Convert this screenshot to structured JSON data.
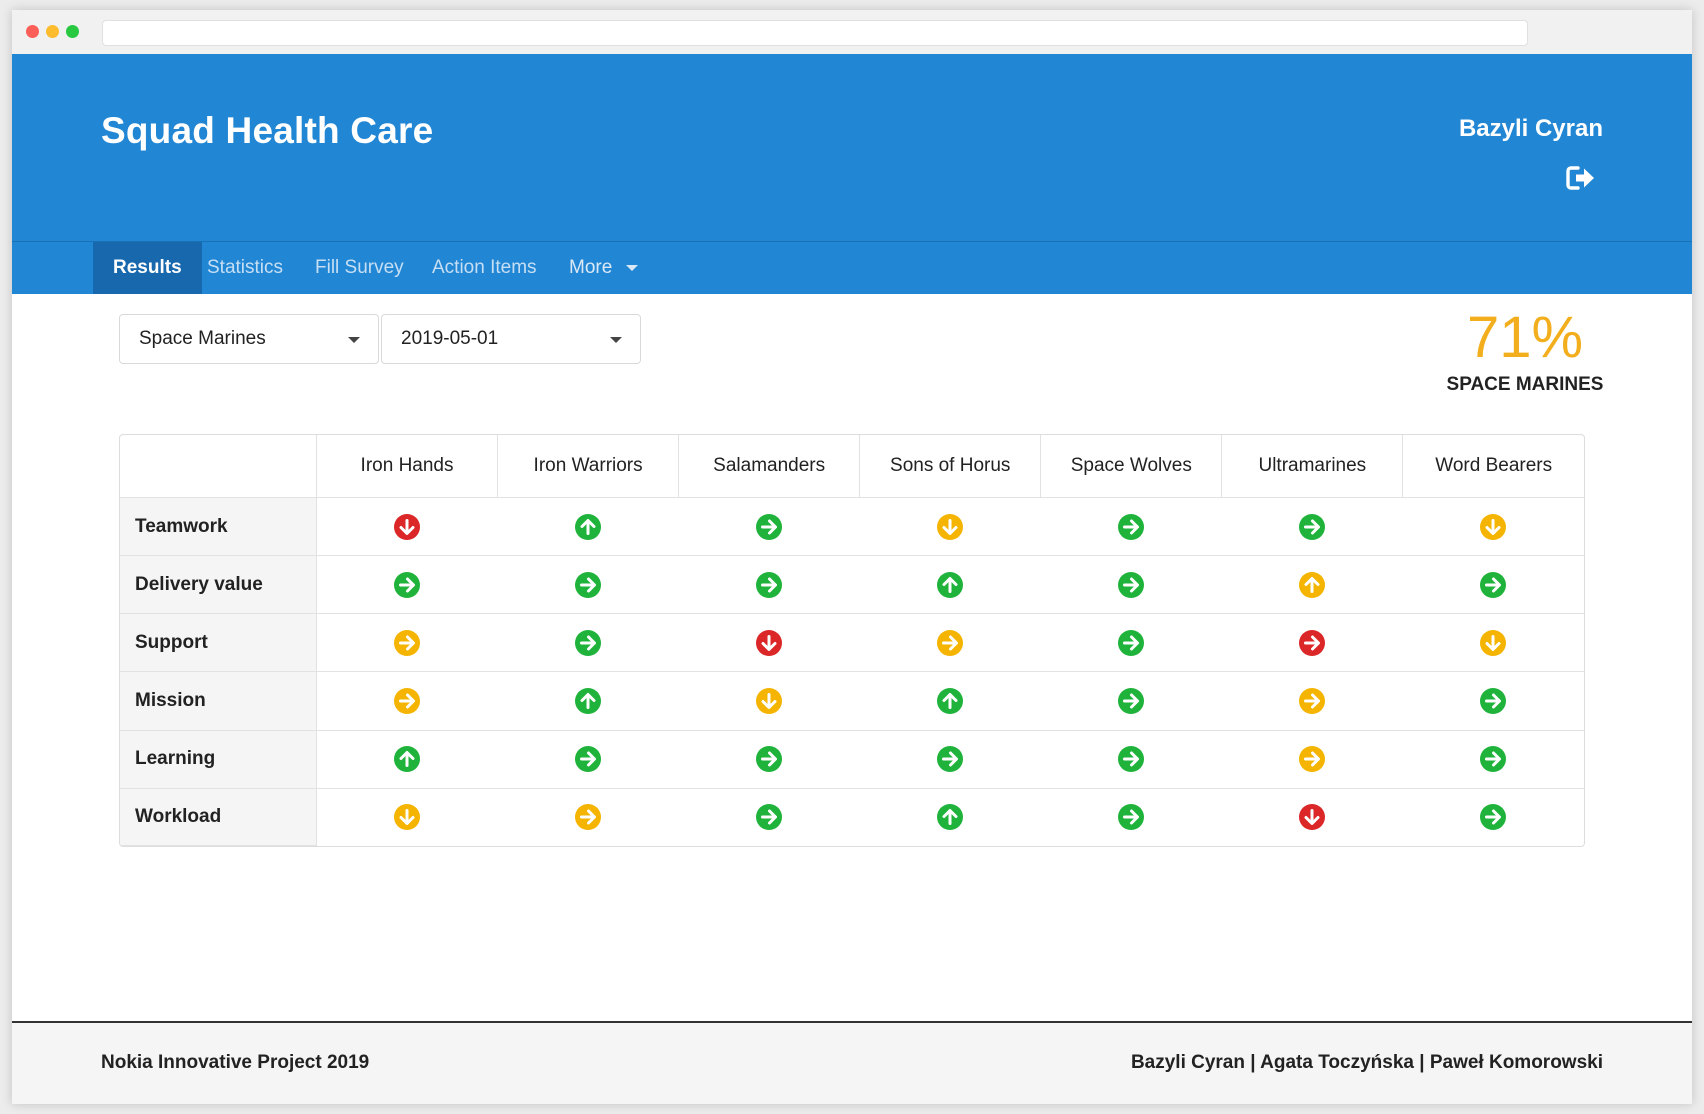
{
  "header": {
    "title": "Squad Health Care",
    "user_name": "Bazyli Cyran",
    "logout_icon": "sign-out-icon"
  },
  "nav": {
    "items": [
      {
        "label": "Results",
        "active": true
      },
      {
        "label": "Statistics",
        "active": false
      },
      {
        "label": "Fill Survey",
        "active": false
      },
      {
        "label": "Action Items",
        "active": false
      },
      {
        "label": "More",
        "active": false,
        "dropdown": true
      }
    ]
  },
  "filters": {
    "squad": "Space Marines",
    "date": "2019-05-01"
  },
  "summary": {
    "percent": "71%",
    "label": "SPACE MARINES",
    "color": "#f2ae1c"
  },
  "colors": {
    "green": "#1fb33c",
    "yellow": "#f4b400",
    "red": "#db2727",
    "header_blue": "#2186d4",
    "nav_active": "#1868ad"
  },
  "table": {
    "columns": [
      "Iron Hands",
      "Iron Warriors",
      "Salamanders",
      "Sons of Horus",
      "Space Wolves",
      "Ultramarines",
      "Word Bearers"
    ],
    "rows": [
      {
        "label": "Teamwork",
        "cells": [
          [
            "red",
            "down"
          ],
          [
            "green",
            "up"
          ],
          [
            "green",
            "right"
          ],
          [
            "yellow",
            "down"
          ],
          [
            "green",
            "right"
          ],
          [
            "green",
            "right"
          ],
          [
            "yellow",
            "down"
          ]
        ]
      },
      {
        "label": "Delivery value",
        "cells": [
          [
            "green",
            "right"
          ],
          [
            "green",
            "right"
          ],
          [
            "green",
            "right"
          ],
          [
            "green",
            "up"
          ],
          [
            "green",
            "right"
          ],
          [
            "yellow",
            "up"
          ],
          [
            "green",
            "right"
          ]
        ]
      },
      {
        "label": "Support",
        "cells": [
          [
            "yellow",
            "right"
          ],
          [
            "green",
            "right"
          ],
          [
            "red",
            "down"
          ],
          [
            "yellow",
            "right"
          ],
          [
            "green",
            "right"
          ],
          [
            "red",
            "right"
          ],
          [
            "yellow",
            "down"
          ]
        ]
      },
      {
        "label": "Mission",
        "cells": [
          [
            "yellow",
            "right"
          ],
          [
            "green",
            "up"
          ],
          [
            "yellow",
            "down"
          ],
          [
            "green",
            "up"
          ],
          [
            "green",
            "right"
          ],
          [
            "yellow",
            "right"
          ],
          [
            "green",
            "right"
          ]
        ]
      },
      {
        "label": "Learning",
        "cells": [
          [
            "green",
            "up"
          ],
          [
            "green",
            "right"
          ],
          [
            "green",
            "right"
          ],
          [
            "green",
            "right"
          ],
          [
            "green",
            "right"
          ],
          [
            "yellow",
            "right"
          ],
          [
            "green",
            "right"
          ]
        ]
      },
      {
        "label": "Workload",
        "cells": [
          [
            "yellow",
            "down"
          ],
          [
            "yellow",
            "right"
          ],
          [
            "green",
            "right"
          ],
          [
            "green",
            "up"
          ],
          [
            "green",
            "right"
          ],
          [
            "red",
            "down"
          ],
          [
            "green",
            "right"
          ]
        ]
      }
    ]
  },
  "footer": {
    "left": "Nokia Innovative Project 2019",
    "right": "Bazyli Cyran | Agata Toczyńska | Paweł Komorowski"
  }
}
